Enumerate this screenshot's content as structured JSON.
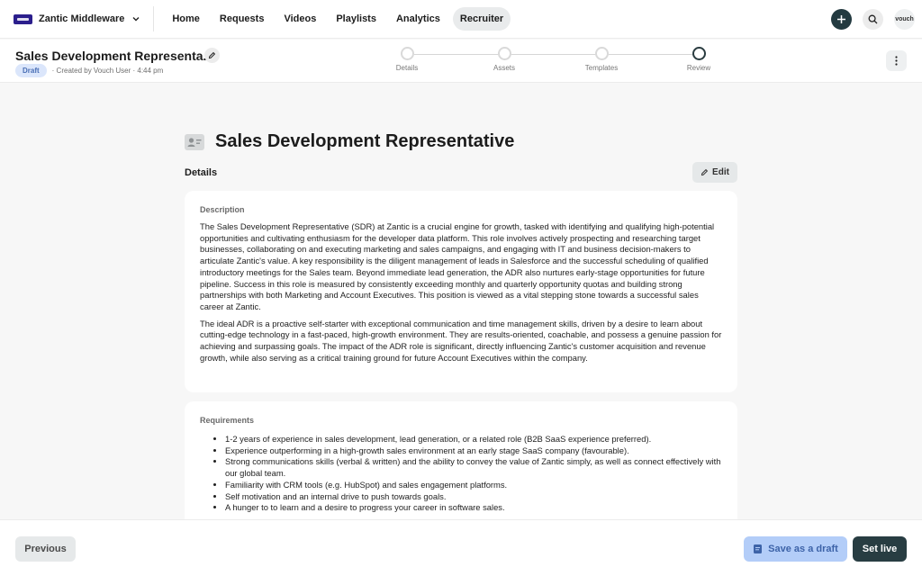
{
  "app": {
    "name": "Zantic Middleware"
  },
  "nav": {
    "links": [
      "Home",
      "Requests",
      "Videos",
      "Playlists",
      "Analytics",
      "Recruiter"
    ],
    "active": "Recruiter",
    "avatar_text": "vouch"
  },
  "header": {
    "title": "Sales Development Representa...",
    "status_badge": "Draft",
    "meta": "· Created by Vouch User · 4:44 pm"
  },
  "stepper": {
    "steps": [
      "Details",
      "Assets",
      "Templates",
      "Review"
    ],
    "current": "Review"
  },
  "main": {
    "title": "Sales Development Representative",
    "section_title": "Details",
    "edit_label": "Edit",
    "description_label": "Description",
    "description": [
      "The Sales Development Representative (SDR) at Zantic is a crucial engine for growth, tasked with identifying and qualifying high-potential opportunities and cultivating enthusiasm for the developer data platform. This role involves actively prospecting and researching target businesses, collaborating on and executing marketing and sales campaigns, and engaging with IT and business decision-makers to articulate Zantic's value. A key responsibility is the diligent management of leads in Salesforce and the successful scheduling of qualified introductory meetings for the Sales team. Beyond immediate lead generation, the ADR also nurtures early-stage opportunities for future pipeline. Success in this role is measured by consistently exceeding monthly and quarterly opportunity quotas and building strong partnerships with both Marketing and Account Executives. This position is viewed as a vital stepping stone towards a successful sales career at Zantic.",
      "The ideal ADR is a proactive self-starter with exceptional communication and time management skills, driven by a desire to learn about cutting-edge technology in a fast-paced, high-growth environment. They are results-oriented, coachable, and possess a genuine passion for achieving and surpassing goals. The impact of the ADR role is significant, directly influencing Zantic's customer acquisition and revenue growth, while also serving as a critical training ground for future Account Executives within the company."
    ],
    "requirements_label": "Requirements",
    "requirements": [
      "1-2 years of experience in sales development, lead generation, or a related role (B2B SaaS experience preferred).",
      "Experience outperforming in a high-growth sales environment at an early stage SaaS company (favourable).",
      "Strong communications skills (verbal & written)  and the ability to convey the value of Zantic simply, as well as connect effectively with our global team.",
      "Familiarity with CRM tools (e.g. HubSpot) and sales engagement platforms.",
      "Self motivation and an internal drive to push towards goals.",
      "A hunger to to learn and a desire to progress your career in software sales."
    ]
  },
  "footer": {
    "previous_label": "Previous",
    "save_draft_label": "Save as a draft",
    "set_live_label": "Set live"
  },
  "colors": {
    "dark_teal": "#283d42",
    "draft_blue": "#b3cdf8",
    "brand_purple": "#2b1e8c"
  }
}
